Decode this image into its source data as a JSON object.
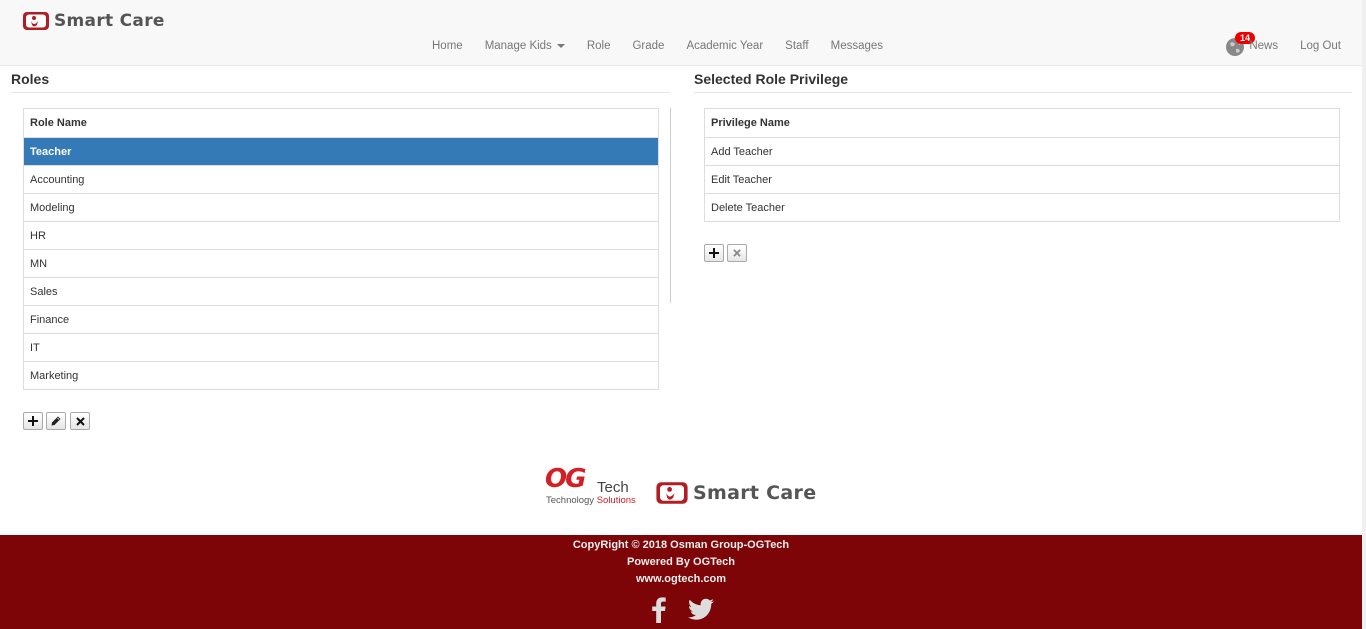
{
  "brand": {
    "name": "Smart Care"
  },
  "nav": {
    "items": [
      {
        "label": "Home"
      },
      {
        "label": "Manage Kids"
      },
      {
        "label": "Role"
      },
      {
        "label": "Grade"
      },
      {
        "label": "Academic Year"
      },
      {
        "label": "Staff"
      },
      {
        "label": "Messages"
      }
    ],
    "notification_count": "14",
    "news_label": "News",
    "logout_label": "Log Out"
  },
  "roles_panel": {
    "title": "Roles",
    "column_header": "Role Name",
    "rows": [
      "Teacher",
      "Accounting",
      "Modeling",
      "HR",
      "MN",
      "Sales",
      "Finance",
      "IT",
      "Marketing"
    ],
    "selected_row": "Teacher",
    "actions": {
      "add_icon": "plus-icon",
      "edit_icon": "pencil-icon",
      "delete_icon": "x-icon"
    }
  },
  "privilege_panel": {
    "title": "Selected Role Privilege",
    "column_header": "Privilege Name",
    "rows": [
      "Add Teacher",
      "Edit Teacher",
      "Delete Teacher"
    ],
    "actions": {
      "add_icon": "plus-icon",
      "delete_icon": "x-icon"
    }
  },
  "footer_logos": {
    "og_mark": "OG",
    "og_word": "Tech",
    "og_tagline_1": "Technology ",
    "og_tagline_2": "Solutions",
    "smart_care": "Smart Care"
  },
  "footer": {
    "copyright": "CopyRight © 2018 Osman Group-OGTech",
    "powered": "Powered By OGTech",
    "website": "www.ogtech.com",
    "social_icons": [
      "facebook-icon",
      "twitter-icon"
    ]
  },
  "colors": {
    "selected_row": "#337ab7",
    "footer_bg": "#7d0407",
    "badge": "#ee0000",
    "brand_red": "#d32027"
  }
}
